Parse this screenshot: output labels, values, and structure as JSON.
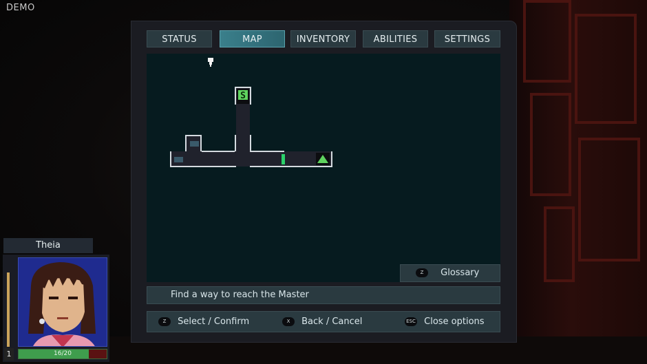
{
  "build_label": "DEMO",
  "menu": {
    "tabs": [
      {
        "label": "STATUS",
        "active": false
      },
      {
        "label": "MAP",
        "active": true
      },
      {
        "label": "INVENTORY",
        "active": false
      },
      {
        "label": "ABILITIES",
        "active": false
      },
      {
        "label": "SETTINGS",
        "active": false
      }
    ]
  },
  "map": {
    "save_room_label": "S",
    "glossary": {
      "key": "Z",
      "label": "Glossary"
    }
  },
  "objective": "Find a way to reach the Master",
  "controls": [
    {
      "key": "Z",
      "label": "Select / Confirm"
    },
    {
      "key": "X",
      "label": "Back / Cancel"
    },
    {
      "key": "ESC",
      "label": "Close options"
    }
  ],
  "character": {
    "name": "Theia",
    "level": "1",
    "hp_text": "16/20",
    "hp_fraction": 0.8
  },
  "colors": {
    "accent": "#3a7f8b",
    "panel": "#2a3a40",
    "map_bg": "#061b1f",
    "save_green": "#5fd35f",
    "hp_green": "#3f9d4d",
    "hp_empty": "#5a1212"
  }
}
